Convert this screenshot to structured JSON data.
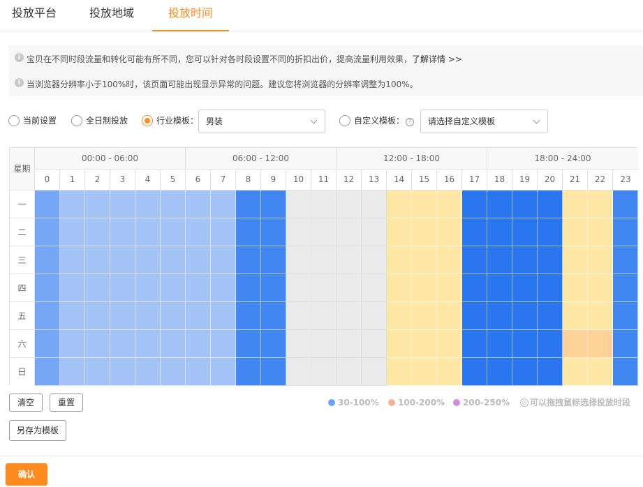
{
  "tabs": [
    {
      "label": "投放平台"
    },
    {
      "label": "投放地域"
    },
    {
      "label": "投放时间"
    }
  ],
  "tips": {
    "line1": "宝贝在不同时段流量和转化可能有所不同，您可以针对各时段设置不同的折扣出价，提高流量利用效果，",
    "line1_link": "了解详情 >>",
    "line2": "当浏览器分辨率小于100%时，该页面可能出现显示异常的问题。建议您将浏览器的分辨率调整为100%。"
  },
  "options": {
    "current": "当前设置",
    "allday": "全日制投放",
    "industry": "行业模板：",
    "industry_value": "男装",
    "custom": "自定义模板：",
    "custom_placeholder": "请选择自定义模板"
  },
  "grid": {
    "weekday_header": "星期",
    "ranges": [
      "00:00 - 06:00",
      "06:00 - 12:00",
      "12:00 - 18:00",
      "18:00 - 24:00"
    ],
    "hours": [
      "0",
      "1",
      "2",
      "3",
      "4",
      "5",
      "6",
      "7",
      "8",
      "9",
      "10",
      "11",
      "12",
      "13",
      "14",
      "15",
      "16",
      "17",
      "18",
      "19",
      "20",
      "21",
      "22",
      "23"
    ],
    "days": [
      "一",
      "二",
      "三",
      "四",
      "五",
      "六",
      "日"
    ],
    "levels": [
      [
        2,
        1,
        1,
        1,
        1,
        1,
        1,
        1,
        3,
        3,
        0,
        0,
        0,
        0,
        5,
        5,
        5,
        4,
        4,
        4,
        4,
        5,
        5,
        3
      ],
      [
        2,
        1,
        1,
        1,
        1,
        1,
        1,
        1,
        3,
        3,
        0,
        0,
        0,
        0,
        5,
        5,
        5,
        4,
        4,
        4,
        4,
        5,
        5,
        3
      ],
      [
        2,
        1,
        1,
        1,
        1,
        1,
        1,
        1,
        3,
        3,
        0,
        0,
        0,
        0,
        5,
        5,
        5,
        4,
        4,
        4,
        4,
        5,
        5,
        3
      ],
      [
        2,
        1,
        1,
        1,
        1,
        1,
        1,
        1,
        3,
        3,
        0,
        0,
        0,
        0,
        5,
        5,
        5,
        4,
        4,
        4,
        4,
        5,
        5,
        3
      ],
      [
        2,
        1,
        1,
        1,
        1,
        1,
        1,
        1,
        3,
        3,
        0,
        0,
        0,
        0,
        5,
        5,
        5,
        4,
        4,
        4,
        4,
        5,
        5,
        3
      ],
      [
        2,
        1,
        1,
        1,
        1,
        1,
        1,
        1,
        3,
        3,
        0,
        0,
        0,
        0,
        5,
        5,
        5,
        4,
        4,
        4,
        4,
        6,
        6,
        3
      ],
      [
        2,
        1,
        1,
        1,
        1,
        1,
        1,
        1,
        3,
        3,
        0,
        0,
        0,
        0,
        5,
        5,
        5,
        4,
        4,
        4,
        4,
        5,
        5,
        3
      ]
    ]
  },
  "buttons": {
    "clear": "清空",
    "reset": "重置",
    "save_template": "另存为模板",
    "confirm": "确认"
  },
  "legend": [
    {
      "label": "30-100%",
      "color": "#6ea4f5"
    },
    {
      "label": "100-200%",
      "color": "#f8b28e"
    },
    {
      "label": "200-250%",
      "color": "#d58ae6"
    }
  ],
  "hint": "可以拖拽鼠标选择投放时段",
  "colors": {
    "accent": "#ff8b1f"
  }
}
